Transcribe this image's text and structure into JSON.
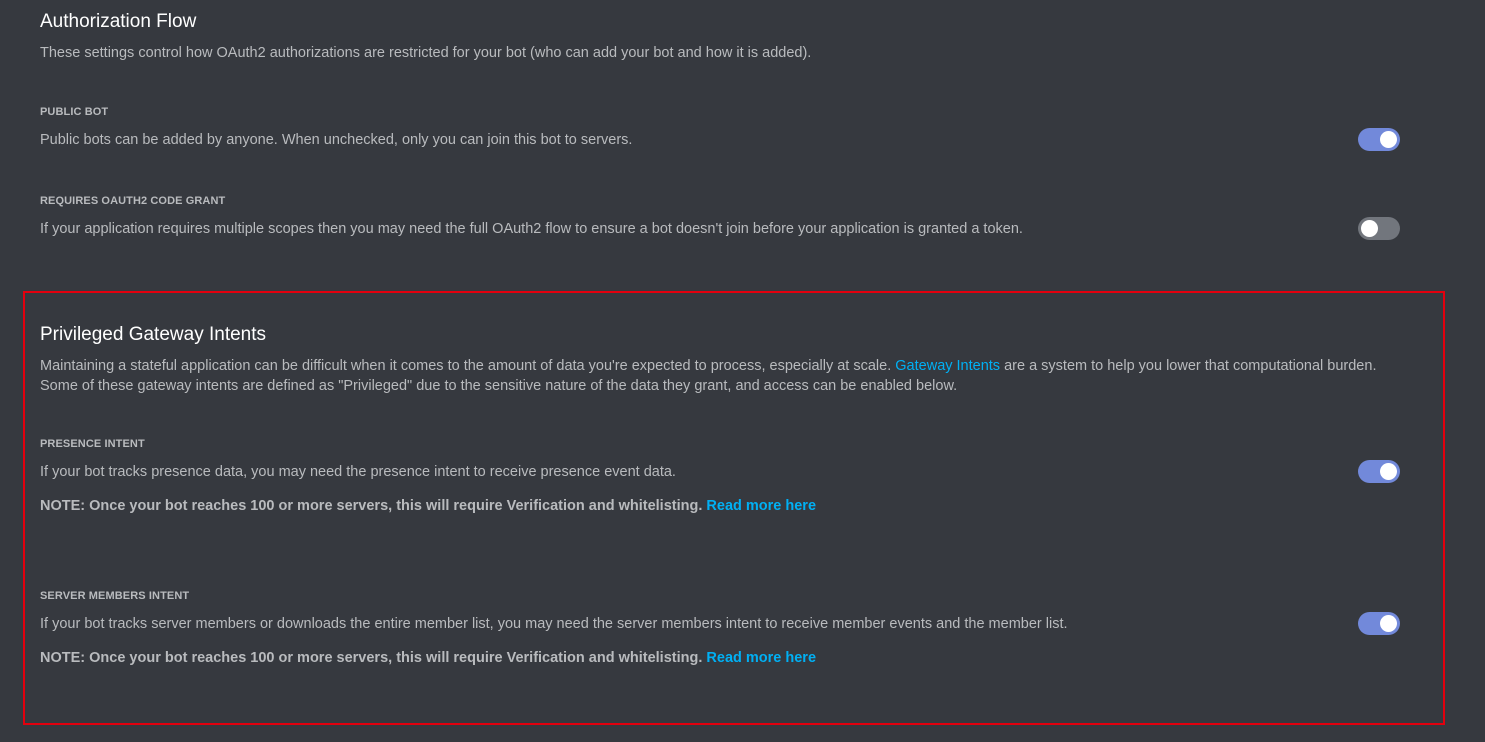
{
  "authorization_flow": {
    "title": "Authorization Flow",
    "description": "These settings control how OAuth2 authorizations are restricted for your bot (who can add your bot and how it is added).",
    "public_bot": {
      "label": "PUBLIC BOT",
      "description": "Public bots can be added by anyone. When unchecked, only you can join this bot to servers.",
      "enabled": true
    },
    "code_grant": {
      "label": "REQUIRES OAUTH2 CODE GRANT",
      "description": "If your application requires multiple scopes then you may need the full OAuth2 flow to ensure a bot doesn't join before your application is granted a token.",
      "enabled": false
    }
  },
  "privileged_intents": {
    "title": "Privileged Gateway Intents",
    "description_part1": "Maintaining a stateful application can be difficult when it comes to the amount of data you're expected to process, especially at scale. ",
    "description_link": "Gateway Intents",
    "description_part2": " are a system to help you lower that computational burden. Some of these gateway intents are defined as \"Privileged\" due to the sensitive nature of the data they grant, and access can be enabled below.",
    "presence": {
      "label": "PRESENCE INTENT",
      "description": "If your bot tracks presence data, you may need the presence intent to receive presence event data.",
      "note": "NOTE: Once your bot reaches 100 or more servers, this will require Verification and whitelisting. ",
      "note_link": "Read more here",
      "enabled": true
    },
    "server_members": {
      "label": "SERVER MEMBERS INTENT",
      "description": "If your bot tracks server members or downloads the entire member list, you may need the server members intent to receive member events and the member list.",
      "note": "NOTE: Once your bot reaches 100 or more servers, this will require Verification and whitelisting. ",
      "note_link": "Read more here",
      "enabled": true
    }
  },
  "colors": {
    "background": "#36393f",
    "toggle_on": "#7289da",
    "toggle_off": "#72767d",
    "link": "#00b0f4",
    "highlight_border": "#e3000e"
  }
}
